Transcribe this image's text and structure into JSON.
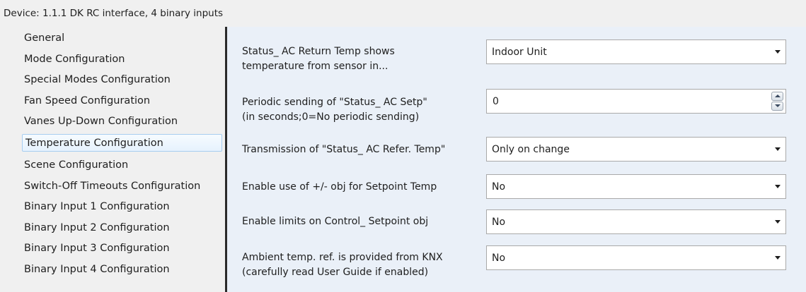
{
  "window": {
    "title": "Device: 1.1.1  DK RC interface, 4 binary inputs"
  },
  "sidebar": {
    "items": [
      {
        "label": "General"
      },
      {
        "label": "Mode Configuration"
      },
      {
        "label": "Special Modes Configuration"
      },
      {
        "label": "Fan Speed Configuration"
      },
      {
        "label": "Vanes Up-Down Configuration"
      },
      {
        "label": "Temperature Configuration",
        "selected": true
      },
      {
        "label": "Scene Configuration"
      },
      {
        "label": "Switch-Off Timeouts Configuration"
      },
      {
        "label": "Binary Input 1 Configuration"
      },
      {
        "label": "Binary Input 2 Configuration"
      },
      {
        "label": "Binary Input 3 Configuration"
      },
      {
        "label": "Binary Input 4 Configuration"
      }
    ]
  },
  "params": {
    "return_temp": {
      "label_line1": "Status_ AC Return Temp shows",
      "label_line2": "temperature from sensor in...",
      "value": "Indoor Unit"
    },
    "periodic_setp": {
      "label_line1": "Periodic sending of \"Status_ AC Setp\"",
      "label_line2": "(in seconds;0=No periodic sending)",
      "value": "0"
    },
    "refer_temp": {
      "label": "Transmission of \"Status_ AC Refer. Temp\"",
      "value": "Only on change"
    },
    "plus_minus": {
      "label": "Enable use of +/- obj for Setpoint Temp",
      "value": "No"
    },
    "limits": {
      "label": "Enable limits on Control_ Setpoint obj",
      "value": "No"
    },
    "ambient_knx": {
      "label_line1": "Ambient temp. ref. is provided from KNX",
      "label_line2": "(carefully read User Guide if enabled)",
      "value": "No"
    }
  },
  "colors": {
    "content_bg": "#eaf0f8",
    "selected_border": "#a7cdf0",
    "splitter": "#2a2a2a"
  },
  "icons": {
    "dropdown": "chevron-down-icon",
    "spin_up": "spin-up-icon",
    "spin_down": "spin-down-icon"
  }
}
